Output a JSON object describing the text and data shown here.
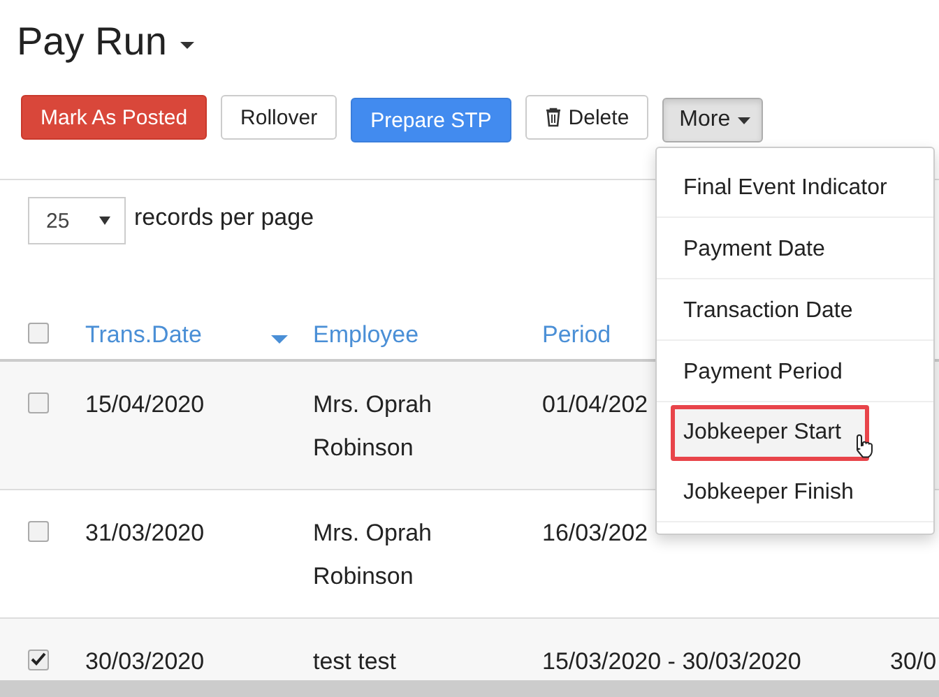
{
  "page": {
    "title": "Pay Run"
  },
  "buttons": [
    {
      "label": "Mark As Posted",
      "kind": "danger"
    },
    {
      "label": "Rollover",
      "kind": "default"
    },
    {
      "label": "Prepare STP",
      "kind": "primary"
    },
    {
      "label": "Delete",
      "kind": "delete"
    },
    {
      "label": "More",
      "kind": "dropdown",
      "expanded": true
    }
  ],
  "menu": {
    "items": [
      {
        "label": "Final Event Indicator",
        "highlighted": false
      },
      {
        "label": "Payment Date",
        "highlighted": false
      },
      {
        "label": "Transaction Date",
        "highlighted": false
      },
      {
        "label": "Payment Period",
        "highlighted": false
      },
      {
        "label": "Jobkeeper Start",
        "highlighted": true
      },
      {
        "label": "Jobkeeper Finish",
        "highlighted": false
      }
    ]
  },
  "page_size": {
    "value": "25",
    "label": "records per page"
  },
  "table": {
    "select_all": false,
    "columns": [
      {
        "label": "Trans.Date",
        "sorted": true
      },
      {
        "label": "Employee",
        "sorted": false
      },
      {
        "label": "Period",
        "sorted": false
      }
    ],
    "rows": [
      {
        "selected": false,
        "cells": [
          "15/04/2020",
          "Mrs. Oprah Robinson",
          "01/04/202"
        ]
      },
      {
        "selected": false,
        "cells": [
          "31/03/2020",
          "Mrs. Oprah Robinson",
          "16/03/202"
        ]
      },
      {
        "selected": true,
        "cells": [
          "30/03/2020",
          "test test",
          "15/03/2020 - 30/03/2020",
          "30/0"
        ]
      }
    ]
  }
}
